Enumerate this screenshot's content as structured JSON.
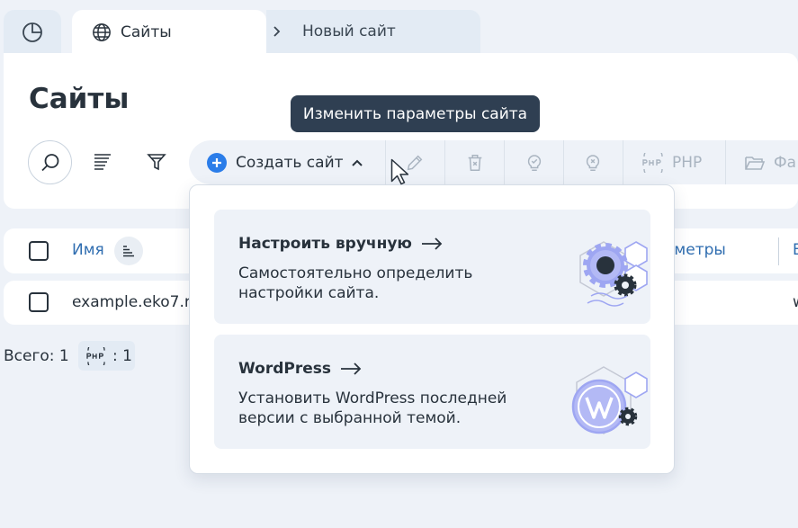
{
  "tabs": {
    "home_icon": "pie-chart-icon",
    "sites_label": "Сайты",
    "new_site_label": "Новый сайт"
  },
  "page": {
    "title": "Сайты"
  },
  "toolbar": {
    "create_label": "Создать сайт",
    "php_label": "PHP",
    "files_label": "Фа"
  },
  "tooltip": {
    "text": "Изменить параметры сайта"
  },
  "table": {
    "columns": {
      "name": "Имя",
      "params": "аметры",
      "extra": "В"
    },
    "rows": [
      {
        "name": "example.eko7.r",
        "extra": "w"
      }
    ]
  },
  "footer": {
    "total": "Всего: 1",
    "php_badge_icon": "php-icon",
    "php_count": ": 1"
  },
  "dropdown": {
    "options": [
      {
        "title": "Настроить вручную",
        "description": "Самостоятельно определить настройки сайта."
      },
      {
        "title": "WordPress",
        "description": "Установить WordPress последней версии с выбранной темой."
      }
    ]
  },
  "colors": {
    "accent": "#2f6db0",
    "create_icon": "#2b7de9",
    "tooltip_bg": "#2f3f52",
    "illustration": "#9ea6f2"
  }
}
